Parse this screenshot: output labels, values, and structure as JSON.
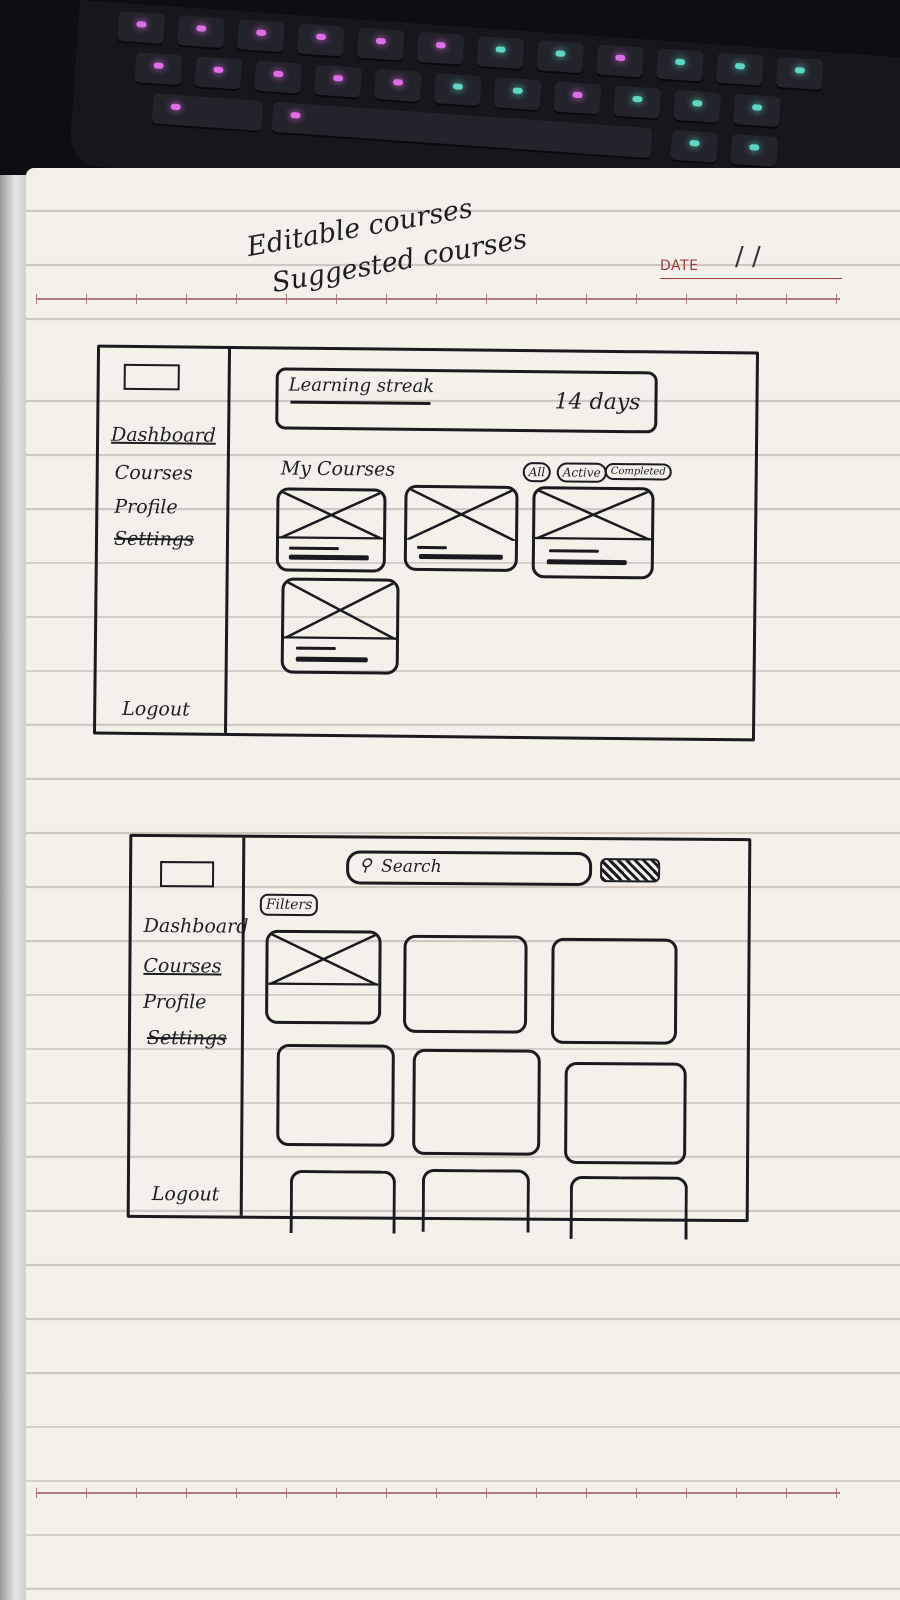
{
  "notes": {
    "line1": "Editable courses",
    "line2": "Suggested courses"
  },
  "page_header": {
    "date_label": "DATE",
    "date_slashes": "/ /"
  },
  "wireframe_dashboard": {
    "sidebar": {
      "items": [
        "Dashboard",
        "Courses",
        "Profile",
        "Settings"
      ],
      "logout": "Logout"
    },
    "streak": {
      "label": "Learning streak",
      "value": "14 days"
    },
    "my_courses": {
      "title": "My Courses",
      "filters": [
        "All",
        "Active",
        "Completed"
      ]
    }
  },
  "wireframe_courses": {
    "sidebar": {
      "items": [
        "Dashboard",
        "Courses",
        "Profile",
        "Settings"
      ],
      "logout": "Logout"
    },
    "search": {
      "icon": "search-icon",
      "placeholder": "Search"
    },
    "filters_button": "Filters"
  }
}
